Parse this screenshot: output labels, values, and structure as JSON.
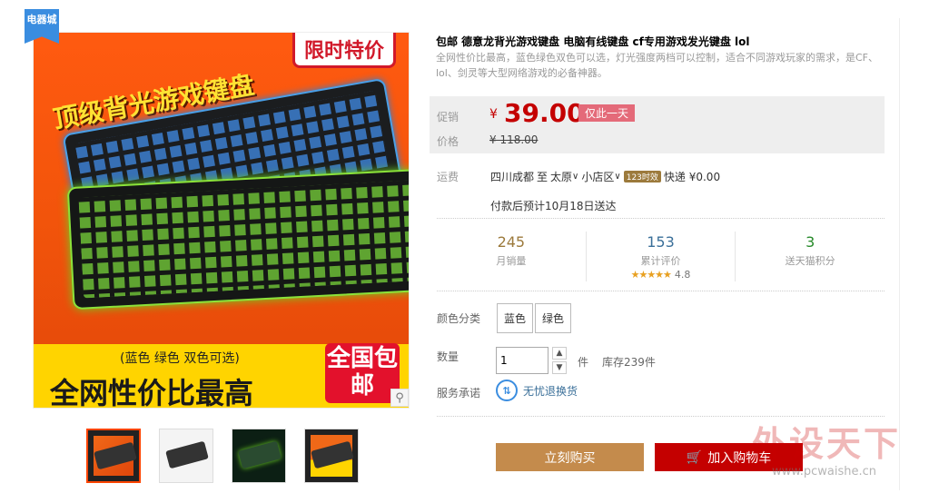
{
  "badge": "电器城",
  "main_image": {
    "headline": "顶级背光游戏键盘",
    "sale_tag": "限时特价",
    "colors_note": "(蓝色 绿色 双色可选)",
    "big_text": "全网性价比最高",
    "nation_tag": "全国包邮"
  },
  "product": {
    "title": "包邮 德意龙背光游戏键盘 电脑有线键盘 cf专用游戏发光键盘 lol",
    "subtitle": "全网性价比最高，蓝色绿色双色可以选，灯光强度两档可以控制，适合不同游戏玩家的需求，是CF、lol、剑灵等大型网络游戏的必备神器。"
  },
  "price": {
    "promo_label": "促销",
    "orig_label": "价格",
    "currency": "¥",
    "value": "39.00",
    "limit_tag": "仅此一天",
    "original": "¥ 118.00"
  },
  "shipping": {
    "label": "运费",
    "from": "四川成都",
    "to_word": "至",
    "city": "太原",
    "district": "小店区",
    "tag": "123时效",
    "method": "快递 ¥0.00",
    "eta": "付款后预计10月18日送达"
  },
  "stats": [
    {
      "num": "245",
      "label": "月销量"
    },
    {
      "num": "153",
      "label": "累计评价",
      "stars": "★★★★★",
      "rating": "4.8"
    },
    {
      "num": "3",
      "label": "送天猫积分"
    }
  ],
  "options": {
    "color_label": "颜色分类",
    "colors": [
      "蓝色",
      "绿色"
    ],
    "qty_label": "数量",
    "qty_value": "1",
    "unit": "件",
    "stock": "库存239件",
    "service_label": "服务承诺",
    "service": "无忧退换货"
  },
  "buttons": {
    "buy": "立刻购买",
    "cart": "加入购物车"
  },
  "watermark": {
    "text": "外设天下",
    "url": "www.pcwaishe.cn"
  },
  "colors": {
    "accent": "#c40000",
    "buy_button": "#c48b4c",
    "badge": "#3a8de0"
  }
}
